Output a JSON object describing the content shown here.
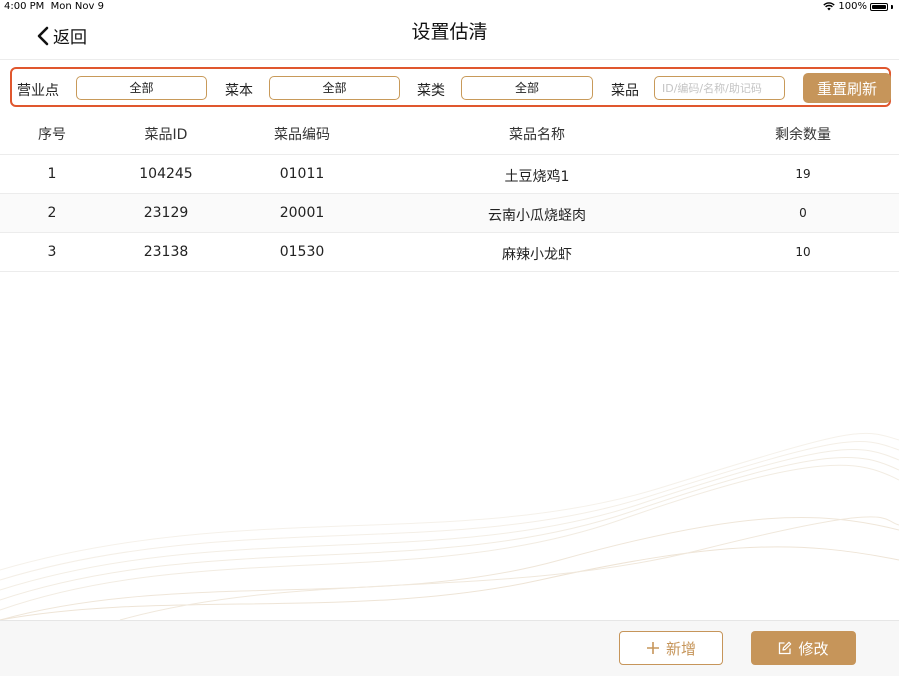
{
  "status_bar": {
    "time": "4:00 PM",
    "date": "Mon Nov 9",
    "battery": "100%"
  },
  "nav": {
    "back_label": "返回",
    "title": "设置估清"
  },
  "filters": {
    "outlet_label": "营业点",
    "outlet_value": "全部",
    "menu_label": "菜本",
    "menu_value": "全部",
    "category_label": "菜类",
    "category_value": "全部",
    "dish_label": "菜品",
    "dish_placeholder": "ID/编码/名称/助记码",
    "reset_label": "重置刷新"
  },
  "table": {
    "headers": [
      "序号",
      "菜品ID",
      "菜品编码",
      "菜品名称",
      "剩余数量"
    ],
    "rows": [
      [
        "1",
        "104245",
        "01011",
        "土豆烧鸡1",
        "19"
      ],
      [
        "2",
        "23129",
        "20001",
        "云南小瓜烧蛏肉",
        "0"
      ],
      [
        "3",
        "23138",
        "01530",
        "麻辣小龙虾",
        "10"
      ]
    ]
  },
  "footer": {
    "add_label": "新增",
    "edit_label": "修改"
  },
  "colors": {
    "accent": "#c6955a",
    "highlight_border": "#e0572e"
  }
}
